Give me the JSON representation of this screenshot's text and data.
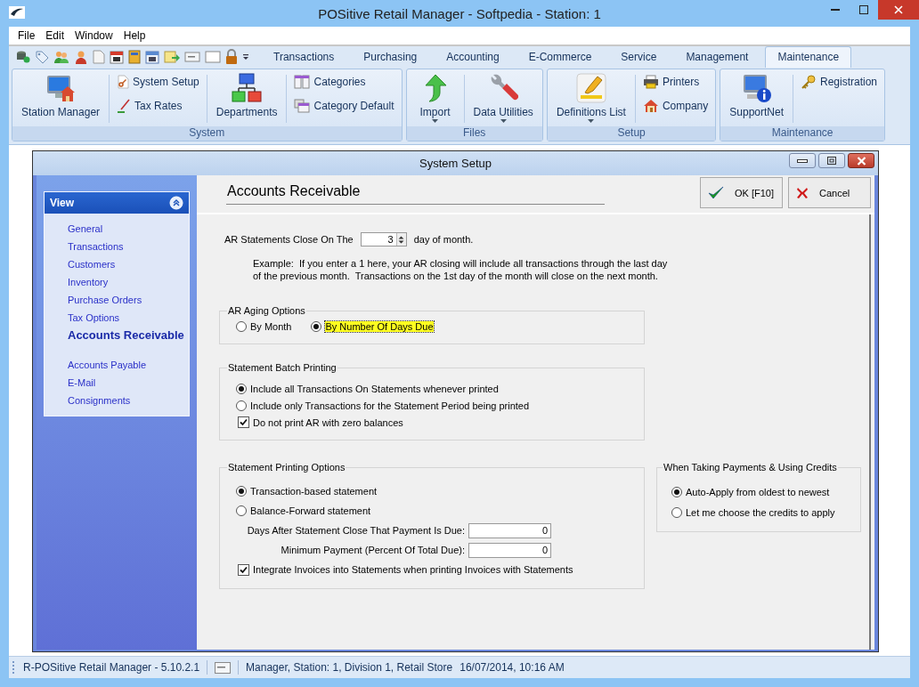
{
  "window": {
    "title": "POSitive Retail Manager - Softpedia - Station: 1"
  },
  "menu": [
    "File",
    "Edit",
    "Window",
    "Help"
  ],
  "tabs": [
    {
      "label": "Transactions",
      "selected": false
    },
    {
      "label": "Purchasing",
      "selected": false
    },
    {
      "label": "Accounting",
      "selected": false
    },
    {
      "label": "E-Commerce",
      "selected": false
    },
    {
      "label": "Service",
      "selected": false
    },
    {
      "label": "Management",
      "selected": false
    },
    {
      "label": "Maintenance",
      "selected": true
    }
  ],
  "ribbon": [
    {
      "label": "System",
      "items": [
        {
          "kind": "large",
          "label": "Station Manager",
          "dropdown": false
        },
        {
          "kind": "column",
          "buttons": [
            "System Setup",
            "Tax Rates"
          ]
        },
        {
          "kind": "large",
          "label": "Departments",
          "dropdown": false
        },
        {
          "kind": "column",
          "buttons": [
            "Categories",
            "Category Default"
          ]
        }
      ]
    },
    {
      "label": "Files",
      "items": [
        {
          "kind": "large",
          "label": "Import",
          "dropdown": true
        },
        {
          "kind": "large",
          "label": "Data Utilities",
          "dropdown": true
        }
      ]
    },
    {
      "label": "Setup",
      "items": [
        {
          "kind": "large",
          "label": "Definitions List",
          "dropdown": true
        },
        {
          "kind": "column",
          "buttons": [
            "Printers",
            "Company"
          ]
        }
      ]
    },
    {
      "label": "Maintenance",
      "items": [
        {
          "kind": "large",
          "label": "SupportNet",
          "dropdown": false
        },
        {
          "kind": "column",
          "buttons": [
            "Registration"
          ]
        }
      ]
    }
  ],
  "dialog": {
    "title": "System Setup",
    "sidebar": {
      "title": "View",
      "sections": [
        {
          "items": [
            {
              "label": "General",
              "selected": false
            },
            {
              "label": "Transactions",
              "selected": false
            },
            {
              "label": "Customers",
              "selected": false
            },
            {
              "label": "Inventory",
              "selected": false
            },
            {
              "label": "Purchase Orders",
              "selected": false
            },
            {
              "label": "Tax Options",
              "selected": false
            },
            {
              "label": "Accounts Receivable",
              "selected": true
            }
          ]
        },
        {
          "items": [
            {
              "label": "Accounts Payable",
              "selected": false
            },
            {
              "label": "E-Mail",
              "selected": false
            },
            {
              "label": "Consignments",
              "selected": false
            }
          ]
        }
      ]
    },
    "heading": "Accounts Receivable",
    "buttons": [
      "OK [F10]",
      "Cancel"
    ],
    "close_day": {
      "label": "AR Statements Close On The",
      "value": "3",
      "suffix": "day of month."
    },
    "example": "Example:  If you enter a 1 here, your AR closing will include all transactions through the last day\nof the previous month.  Transactions on the 1st day of the month will close on the next month.",
    "aging": {
      "title": "AR Aging Options",
      "options": [
        {
          "label": "By Month",
          "selected": false,
          "focused": false
        },
        {
          "label": "By Number Of Days Due",
          "selected": true,
          "focused": true
        }
      ]
    },
    "batch": {
      "title": "Statement Batch Printing",
      "items": [
        {
          "kind": "radio",
          "label": "Include all Transactions On Statements whenever printed",
          "selected": true
        },
        {
          "kind": "radio",
          "label": "Include only Transactions for the Statement Period being printed",
          "selected": false
        },
        {
          "kind": "checkbox",
          "label": "Do not print AR with zero balances",
          "checked": true
        }
      ]
    },
    "printing": {
      "title": "Statement Printing Options",
      "items": [
        {
          "kind": "radio",
          "label": "Transaction-based statement",
          "selected": true
        },
        {
          "kind": "radio",
          "label": "Balance-Forward statement",
          "selected": false
        },
        {
          "kind": "field",
          "label": "Days After Statement Close That Payment Is Due:",
          "value": "0"
        },
        {
          "kind": "field",
          "label": "Minimum Payment (Percent Of Total Due):",
          "value": "0"
        },
        {
          "kind": "checkbox",
          "label": "Integrate Invoices into Statements when printing Invoices with Statements",
          "checked": true
        }
      ]
    },
    "payments": {
      "title": "When Taking Payments & Using Credits",
      "items": [
        {
          "kind": "radio",
          "label": "Auto-Apply from oldest to newest",
          "selected": true
        },
        {
          "kind": "radio",
          "label": "Let me choose the credits to apply",
          "selected": false
        }
      ]
    }
  },
  "status_bar": {
    "version": "R-POSitive Retail Manager - 5.10.2.1",
    "session": "Manager, Station: 1, Division 1, Retail Store",
    "datetime": "16/07/2014, 10:16 AM"
  }
}
